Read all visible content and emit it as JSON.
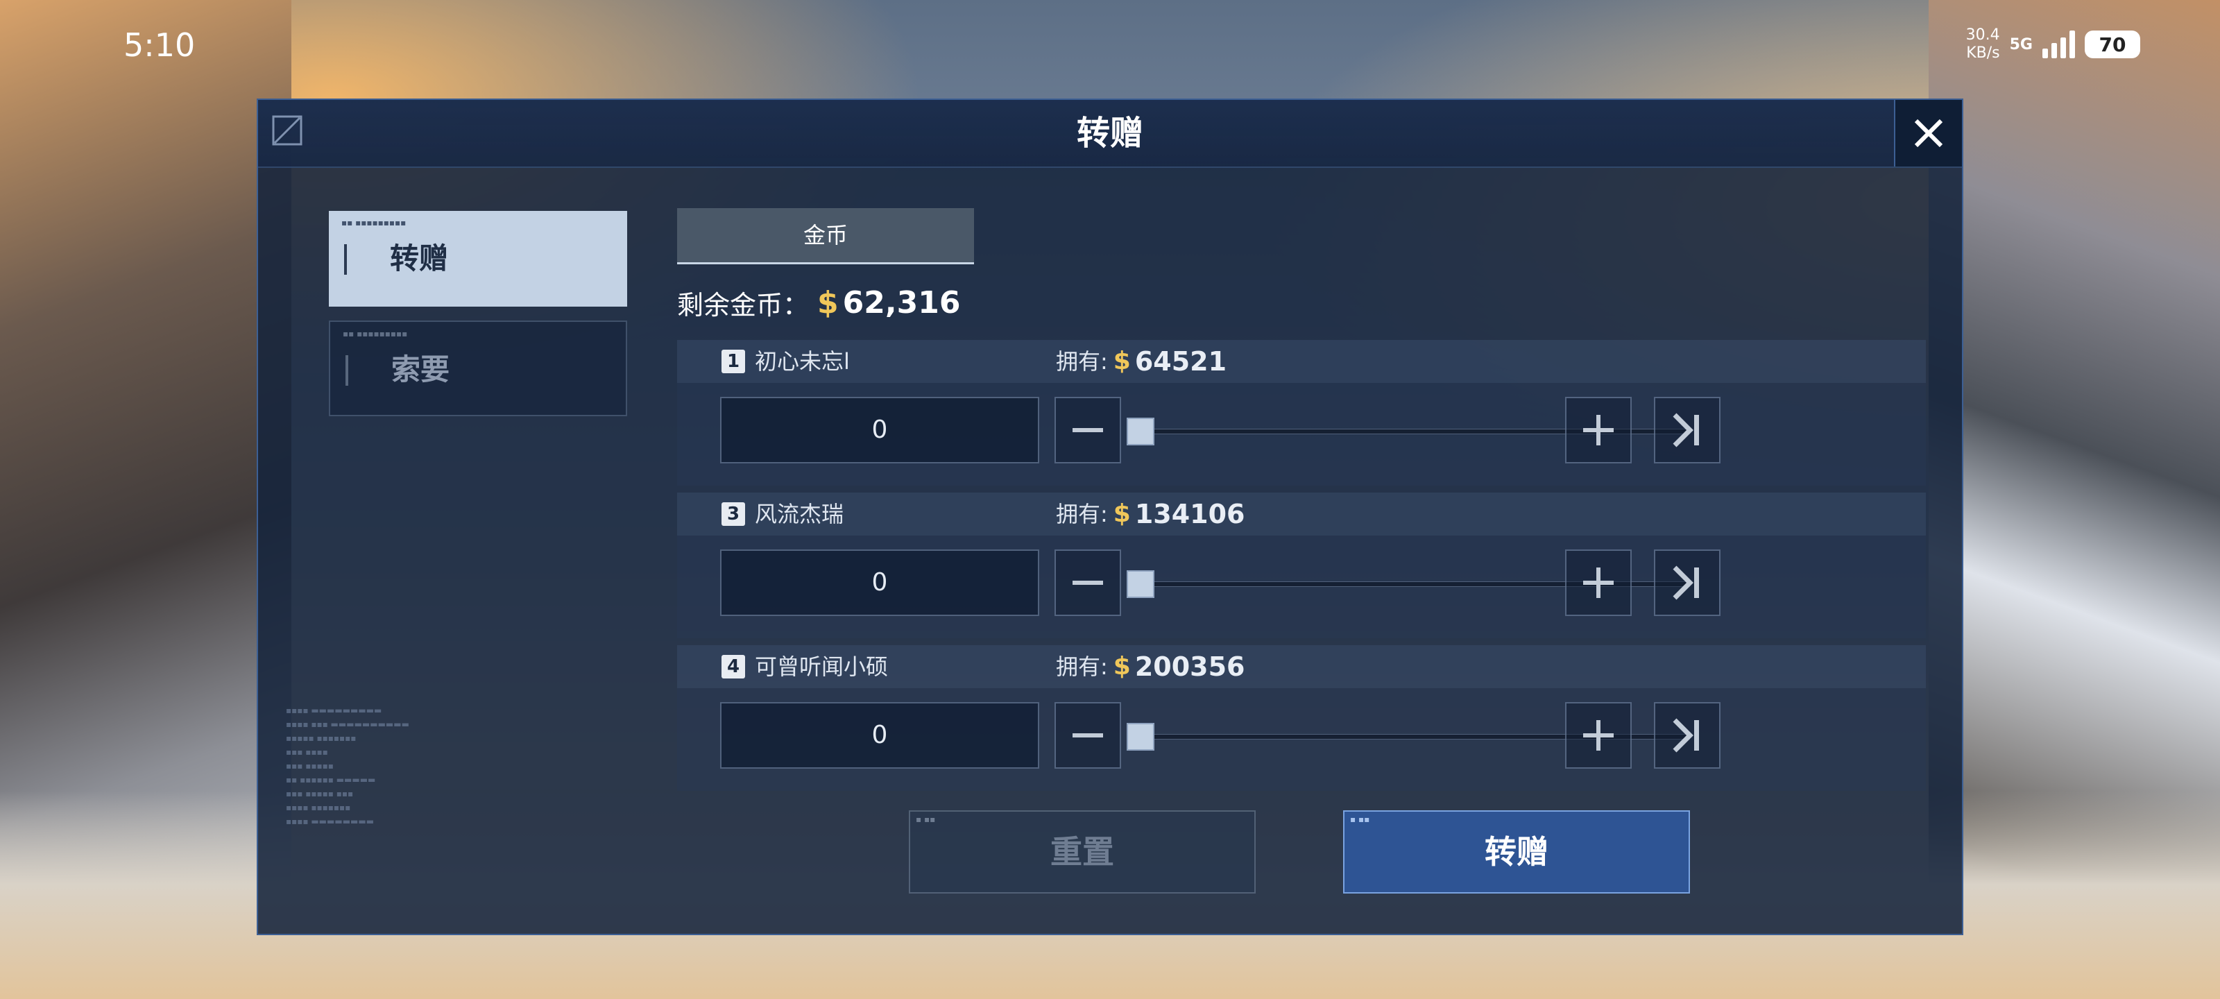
{
  "status": {
    "time": "5:10",
    "net_speed_value": "30.4",
    "net_speed_unit": "KB/s",
    "signal": "5G",
    "battery": "70"
  },
  "dialog": {
    "title": "转赠",
    "tabs": [
      {
        "label": "转赠",
        "active": true
      },
      {
        "label": "索要",
        "active": false
      }
    ],
    "currency_tab": "金币",
    "remaining_label": "剩余金币：",
    "currency_symbol": "$",
    "remaining_value": "62,316",
    "owned_label": "拥有:",
    "players": [
      {
        "rank": "1",
        "name": "初心未忘l",
        "owned": "64521",
        "amount": "0",
        "slider_fraction": 0
      },
      {
        "rank": "3",
        "name": "风流杰瑞",
        "owned": "134106",
        "amount": "0",
        "slider_fraction": 0
      },
      {
        "rank": "4",
        "name": "可曾听闻小硕",
        "owned": "200356",
        "amount": "0",
        "slider_fraction": 0
      }
    ],
    "reset_label": "重置",
    "confirm_label": "转赠"
  },
  "colors": {
    "accent_gold": "#f0c75a",
    "confirm_blue": "#2e5494",
    "panel_bg": "#16243c"
  },
  "icons": [
    "close-icon",
    "minus-icon",
    "plus-icon",
    "max-icon",
    "signal-bars-icon",
    "battery-icon",
    "logo-icon"
  ]
}
